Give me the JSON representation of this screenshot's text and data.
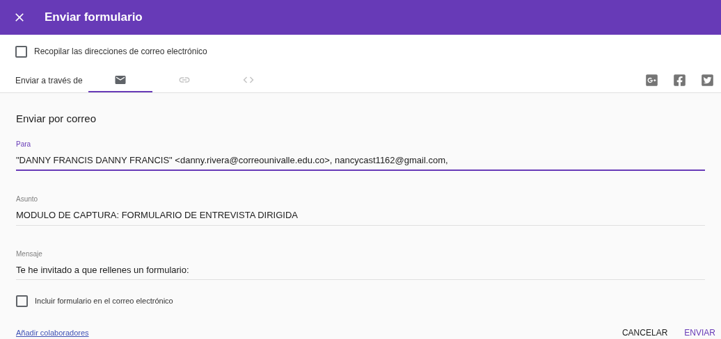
{
  "window": {
    "title": "Enviar formulario"
  },
  "collect_emails": {
    "label": "Recopilar las direcciones de correo electrónico",
    "checked": false
  },
  "send_via": {
    "label": "Enviar a través de",
    "tabs": [
      {
        "kind": "mail",
        "selected": true
      },
      {
        "kind": "link",
        "selected": false
      },
      {
        "kind": "embed",
        "selected": false
      }
    ],
    "social": [
      {
        "kind": "googleplus"
      },
      {
        "kind": "facebook"
      },
      {
        "kind": "twitter"
      }
    ]
  },
  "section_title": "Enviar por correo",
  "fields": [
    {
      "label": "Para",
      "value": "\"DANNY FRANCIS DANNY FRANCIS\" <danny.rivera@correounivalle.edu.co>, nancycast1162@gmail.com,",
      "focused": true
    },
    {
      "label": "Asunto",
      "value": "MODULO DE CAPTURA: FORMULARIO DE ENTREVISTA DIRIGIDA",
      "focused": false
    },
    {
      "label": "Mensaje",
      "value": "Te he invitado a que rellenes un formulario:",
      "focused": false
    }
  ],
  "include_form": {
    "label": "Incluir formulario en el correo electrónico",
    "checked": false
  },
  "add_collaborators": "Añadir colaboradores",
  "buttons": [
    {
      "label": "CANCELAR",
      "kind": "secondary"
    },
    {
      "label": "ENVIAR",
      "kind": "primary"
    }
  ]
}
